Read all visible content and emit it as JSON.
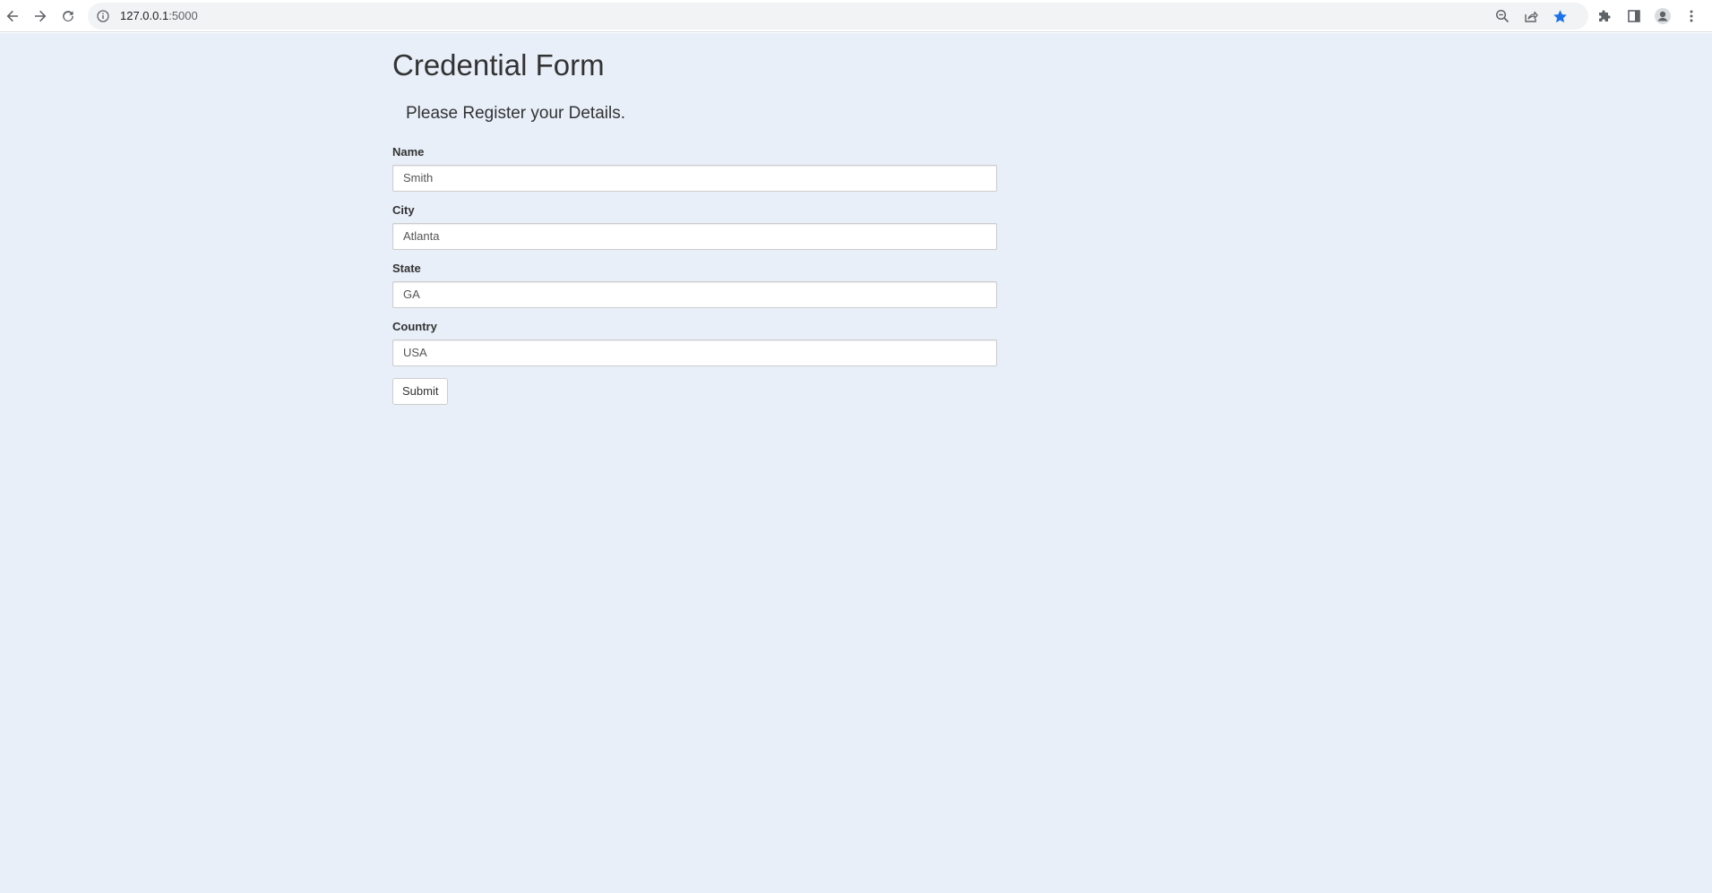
{
  "browser": {
    "url_host": "127.0.0.1",
    "url_port": ":5000",
    "icons": {
      "back": "arrow-left-icon",
      "forward": "arrow-right-icon",
      "reload": "reload-icon",
      "site_info": "info-icon",
      "zoom": "zoom-out-icon",
      "share": "share-icon",
      "bookmark": "star-icon",
      "extensions": "puzzle-icon",
      "side_panel": "side-panel-icon",
      "profile": "avatar-icon",
      "menu": "kebab-menu-icon"
    },
    "colors": {
      "bookmark_star": "#1a73e8",
      "omnibox_bg": "#f1f3f4"
    }
  },
  "page": {
    "title": "Credential Form",
    "subtitle": "Please Register your Details.",
    "background": "#e8eff9"
  },
  "form": {
    "fields": [
      {
        "label": "Name",
        "value": "Smith"
      },
      {
        "label": "City",
        "value": "Atlanta"
      },
      {
        "label": "State",
        "value": "GA"
      },
      {
        "label": "Country",
        "value": "USA"
      }
    ],
    "submit_label": "Submit"
  }
}
